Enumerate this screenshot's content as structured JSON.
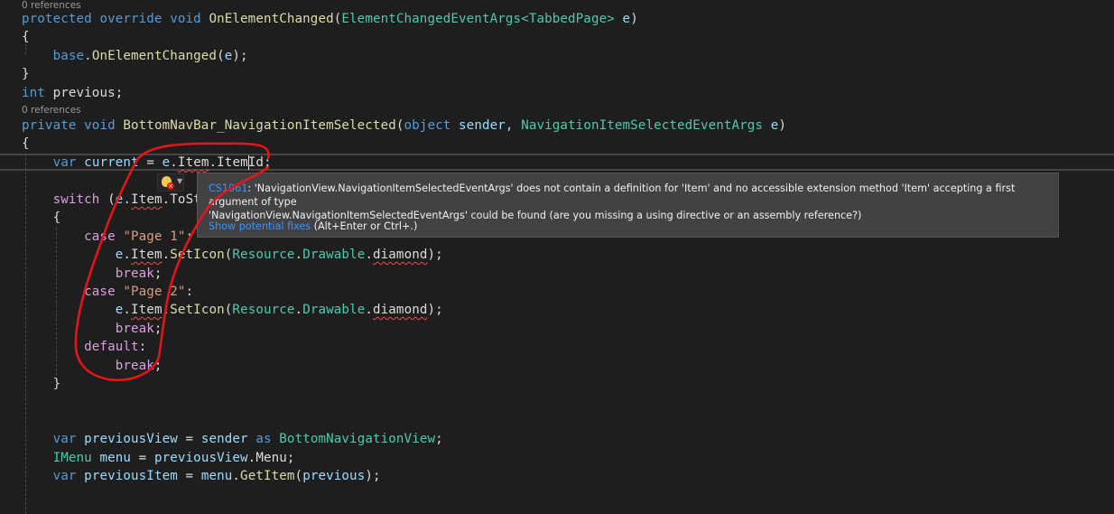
{
  "editor": {
    "references": [
      "0 references",
      "0 references"
    ],
    "lines": {
      "l1": {
        "a": "protected",
        "b": "override",
        "c": "void",
        "d": "OnElementChanged",
        "e": "ElementChangedEventArgs",
        "f": "TabbedPage",
        "g": "e"
      },
      "l2": "{",
      "l3": {
        "a": "base",
        "b": "OnElementChanged",
        "c": "e"
      },
      "l4": "}",
      "l5": {
        "a": "int",
        "b": "previous;"
      },
      "l6": {
        "a": "private",
        "b": "void",
        "c": "BottomNavBar_NavigationItemSelected",
        "d": "object",
        "e": "sender,",
        "f": "NavigationItemSelectedEventArgs",
        "g": "e"
      },
      "l7": "{",
      "l8": {
        "a": "var",
        "b": "current",
        "c": "e",
        "d": "Item",
        "e": "ItemId"
      },
      "l9": {
        "a": "switch",
        "b": "e",
        "c": "Item",
        "d": "ToSt"
      },
      "l10": "{",
      "l11": {
        "a": "case",
        "b": "\"Page 1\""
      },
      "l12": {
        "a": "e",
        "b": "Item",
        "c": "SetIcon",
        "d": "Resource",
        "e": "Drawable",
        "f": "diamond"
      },
      "l13": "break",
      "l14": {
        "a": "case",
        "b": "\"Page 2\""
      },
      "l15": {
        "a": "e",
        "b": "Item",
        "c": "SetIcon",
        "d": "Resource",
        "e": "Drawable",
        "f": "diamond"
      },
      "l16": "break",
      "l17": "default",
      "l18": "break",
      "l19": "}",
      "l20": {
        "a": "var",
        "b": "previousView",
        "c": "sender",
        "d": "as",
        "e": "BottomNavigationView"
      },
      "l21": {
        "a": "IMenu",
        "b": "menu",
        "c": "previousView",
        "d": "Menu"
      },
      "l22": {
        "a": "var",
        "b": "previousItem",
        "c": "menu",
        "d": "GetItem",
        "e": "previous"
      }
    }
  },
  "tooltip": {
    "error_code": "CS1061",
    "message_line1": ": 'NavigationView.NavigationItemSelectedEventArgs' does not contain a definition for 'Item' and no accessible extension method 'Item' accepting a first argument of type",
    "message_line2": "'NavigationView.NavigationItemSelectedEventArgs' could be found (are you missing a using directive or an assembly reference?)",
    "fix_link": "Show potential fixes",
    "fix_shortcut": " (Alt+Enter or Ctrl+.)"
  },
  "lightbulb": {
    "icon": "lightbulb-error-icon"
  },
  "colors": {
    "annotation": "#e8141b",
    "background": "#1e1e1e",
    "link": "#3794ff"
  }
}
